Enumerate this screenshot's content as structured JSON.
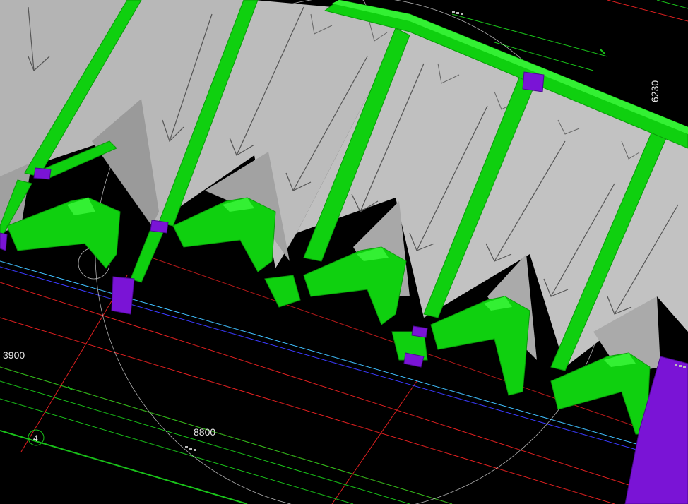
{
  "viewport": {
    "background": "#000000",
    "colors": {
      "beam": "#0fd00f",
      "beam_light": "#33f033",
      "column": "#7a14d6",
      "roof": "#b4b4b4",
      "roof_shadow": "#9a9a9a",
      "axis": "#e02020",
      "grid_green": "#19c019",
      "cyan": "#40c0ff",
      "blue": "#3a3aff",
      "snap_circle": "#dddddd"
    }
  },
  "dimensions": {
    "dim_3900": "3900",
    "dim_8800": "8800",
    "dim_6230": "6230"
  },
  "grid_bubbles": {
    "axis_4": "4"
  }
}
